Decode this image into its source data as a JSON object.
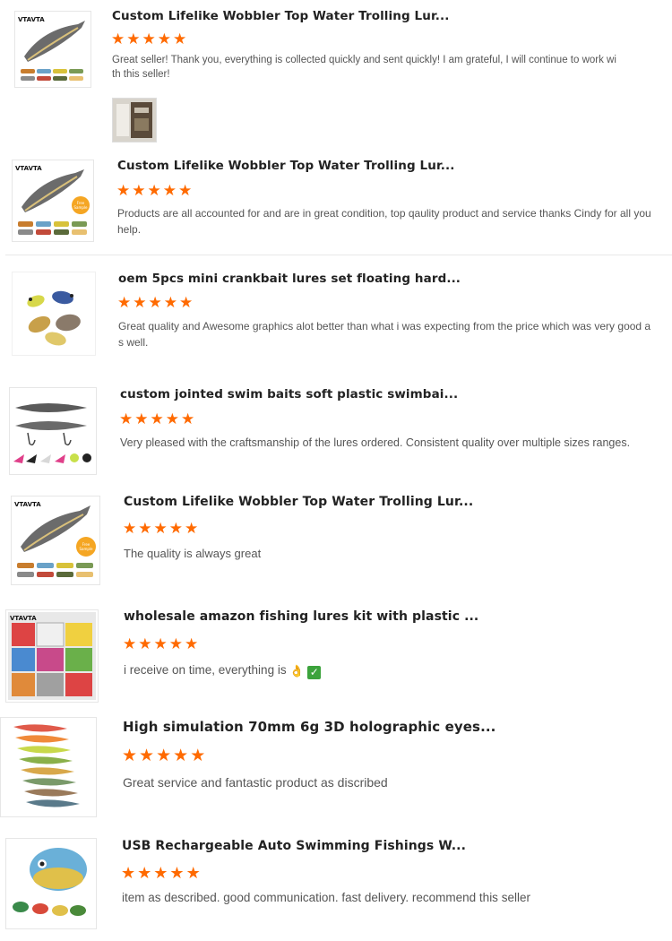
{
  "brand_colors": {
    "star": "#ff6a00",
    "text": "#555555",
    "title": "#222222"
  },
  "reviews": [
    {
      "title": "Custom Lifelike Wobbler Top Water Trolling Lur...",
      "rating": 5,
      "text": "Great seller! Thank you, everything is collected quickly and sent quickly! I am grateful, I will continue to work with this seller!",
      "thumb_logo": "VTAVTA",
      "has_photo": true
    },
    {
      "title": "Custom Lifelike Wobbler Top Water Trolling Lur...",
      "rating": 5,
      "text": "Products are all accounted for and are in great condition, top qaulity product and service thanks Cindy for all you help.",
      "thumb_logo": "VTAVTA",
      "badge": "Free Sample"
    },
    {
      "title": "oem 5pcs mini crankbait lures set floating hard...",
      "rating": 5,
      "text": "Great quality and Awesome graphics alot better than what i was expecting from the price which was very good as well."
    },
    {
      "title": "custom jointed swim baits soft plastic swimbai...",
      "rating": 5,
      "text": "Very pleased with the craftsmanship of the lures ordered. Consistent quality over multiple sizes ranges."
    },
    {
      "title": "Custom Lifelike Wobbler Top Water Trolling Lur...",
      "rating": 5,
      "text": "The quality is always great",
      "thumb_logo": "VTAVTA",
      "badge": "Free Sample"
    },
    {
      "title": "wholesale amazon fishing lures kit with plastic ...",
      "rating": 5,
      "text": "i receive on time, everything is",
      "text_emoji": [
        "ok-hand-icon",
        "check-mark-icon"
      ],
      "thumb_logo": "VTAVTA"
    },
    {
      "title": "High simulation 70mm 6g 3D holographic eyes...",
      "rating": 5,
      "text": "Great service and fantastic product as discribed"
    },
    {
      "title": "USB Rechargeable Auto Swimming Fishings W...",
      "rating": 5,
      "text": "item as described. good communication. fast delivery. recommend this seller"
    }
  ]
}
